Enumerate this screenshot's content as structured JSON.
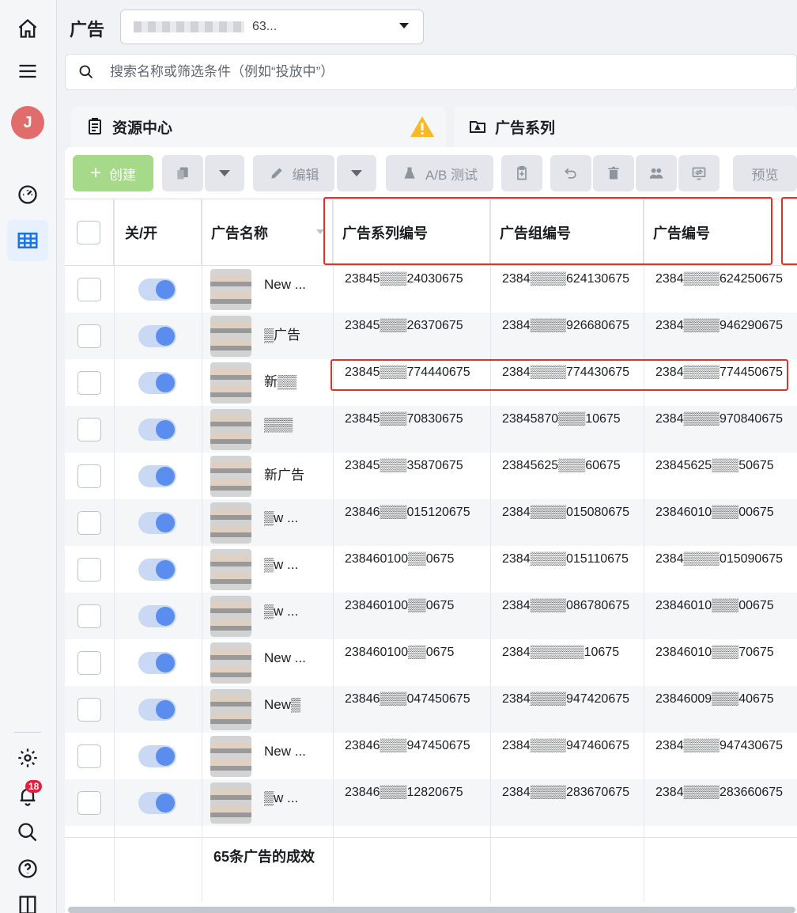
{
  "header": {
    "page_title": "广告",
    "account_label": "63..."
  },
  "search": {
    "placeholder": "搜索名称或筛选条件（例如“投放中”）"
  },
  "tabs": {
    "resource": "资源中心",
    "campaign": "广告系列"
  },
  "toolbar": {
    "create": "创建",
    "edit": "编辑",
    "ab_test": "A/B 测试",
    "preview": "预览"
  },
  "table": {
    "columns": [
      "关/开",
      "广告名称",
      "广告系列编号",
      "广告组编号",
      "广告编号"
    ],
    "rows": [
      {
        "name": "New ...",
        "campaign_id": "23845▒▒▒24030675",
        "adset_id": "2384▒▒▒▒624130675",
        "ad_id": "2384▒▒▒▒624250675"
      },
      {
        "name": "▒广告",
        "campaign_id": "23845▒▒▒26370675",
        "adset_id": "2384▒▒▒▒926680675",
        "ad_id": "2384▒▒▒▒946290675"
      },
      {
        "name": "新▒▒",
        "campaign_id": "23845▒▒▒774440675",
        "adset_id": "2384▒▒▒▒774430675",
        "ad_id": "2384▒▒▒▒774450675"
      },
      {
        "name": "▒▒▒",
        "campaign_id": "23845▒▒▒70830675",
        "adset_id": "23845870▒▒▒10675",
        "ad_id": "2384▒▒▒▒970840675"
      },
      {
        "name": "新广告",
        "campaign_id": "23845▒▒▒35870675",
        "adset_id": "23845625▒▒▒60675",
        "ad_id": "23845625▒▒▒50675"
      },
      {
        "name": "▒w ...",
        "campaign_id": "23846▒▒▒015120675",
        "adset_id": "2384▒▒▒▒015080675",
        "ad_id": "23846010▒▒▒00675"
      },
      {
        "name": "▒w ...",
        "campaign_id": "238460100▒▒0675",
        "adset_id": "2384▒▒▒▒015110675",
        "ad_id": "2384▒▒▒▒015090675"
      },
      {
        "name": "▒w ...",
        "campaign_id": "238460100▒▒0675",
        "adset_id": "2384▒▒▒▒086780675",
        "ad_id": "23846010▒▒▒00675"
      },
      {
        "name": "New ...",
        "campaign_id": "238460100▒▒0675",
        "adset_id": "2384▒▒▒▒▒▒10675",
        "ad_id": "23846010▒▒▒70675"
      },
      {
        "name": "New▒",
        "campaign_id": "23846▒▒▒047450675",
        "adset_id": "2384▒▒▒▒947420675",
        "ad_id": "23846009▒▒▒40675"
      },
      {
        "name": "New ...",
        "campaign_id": "23846▒▒▒947450675",
        "adset_id": "2384▒▒▒▒947460675",
        "ad_id": "2384▒▒▒▒947430675"
      },
      {
        "name": "▒w ...",
        "campaign_id": "23846▒▒▒12820675",
        "adset_id": "2384▒▒▒▒283670675",
        "ad_id": "2384▒▒▒▒283660675"
      }
    ],
    "footer_summary": "65条广告的成效"
  },
  "notifications": {
    "count": "18"
  },
  "user": {
    "avatar_letter": "J"
  }
}
